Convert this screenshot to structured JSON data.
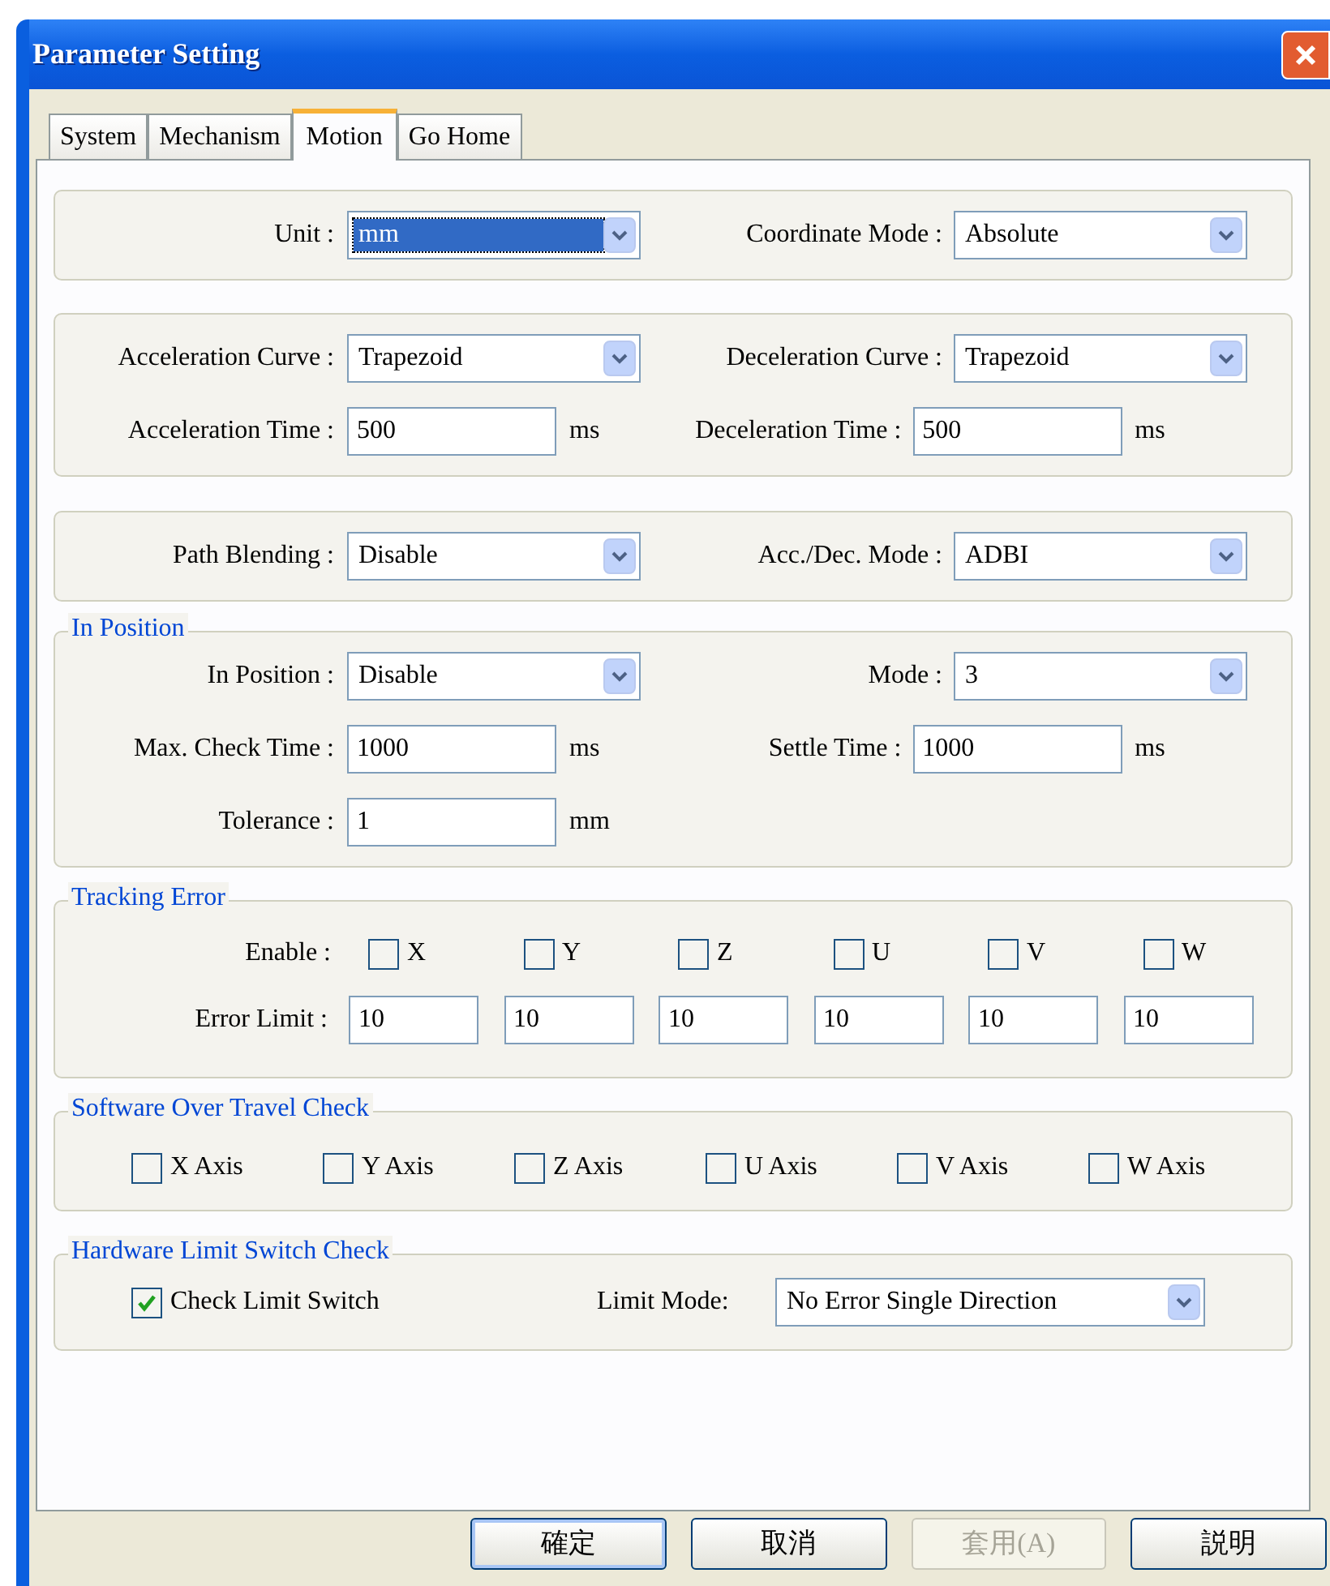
{
  "window": {
    "title": "Parameter Setting"
  },
  "tabs": [
    {
      "label": "System",
      "selected": false
    },
    {
      "label": "Mechanism",
      "selected": false
    },
    {
      "label": "Motion",
      "selected": true
    },
    {
      "label": "Go Home",
      "selected": false
    }
  ],
  "sections": [
    {
      "kind": "fields",
      "rows": [
        [
          {
            "kind": "select",
            "label": "Unit :",
            "value": "mm",
            "focused": true
          },
          {
            "kind": "select",
            "label": "Coordinate Mode :",
            "value": "Absolute",
            "focused": false
          }
        ]
      ]
    },
    {
      "kind": "fields",
      "rows": [
        [
          {
            "kind": "select",
            "label": "Acceleration Curve :",
            "value": "Trapezoid",
            "focused": false
          },
          {
            "kind": "select",
            "label": "Deceleration Curve :",
            "value": "Trapezoid",
            "focused": false
          }
        ],
        [
          {
            "kind": "input",
            "label": "Acceleration Time :",
            "value": "500",
            "unit": "ms"
          },
          {
            "kind": "input",
            "label": "Deceleration Time :",
            "value": "500",
            "unit": "ms"
          }
        ]
      ]
    },
    {
      "kind": "fields",
      "rows": [
        [
          {
            "kind": "select",
            "label": "Path Blending :",
            "value": "Disable",
            "focused": false
          },
          {
            "kind": "select",
            "label": "Acc./Dec. Mode :",
            "value": "ADBI",
            "focused": false
          }
        ]
      ]
    },
    {
      "kind": "fields",
      "title": "In Position",
      "rows": [
        [
          {
            "kind": "select",
            "label": "In Position :",
            "value": "Disable",
            "focused": false
          },
          {
            "kind": "select",
            "label": "Mode :",
            "value": "3",
            "focused": false
          }
        ],
        [
          {
            "kind": "input",
            "label": "Max. Check Time :",
            "value": "1000",
            "unit": "ms"
          },
          {
            "kind": "input",
            "label": "Settle Time :",
            "value": "1000",
            "unit": "ms"
          }
        ],
        [
          {
            "kind": "input",
            "label": "Tolerance :",
            "value": "1",
            "unit": "mm"
          }
        ]
      ]
    },
    {
      "kind": "axes",
      "title": "Tracking Error",
      "enable_label": "Enable :",
      "limit_label": "Error Limit :",
      "axes": [
        {
          "name": "X",
          "checked": false,
          "limit": "10"
        },
        {
          "name": "Y",
          "checked": false,
          "limit": "10"
        },
        {
          "name": "Z",
          "checked": false,
          "limit": "10"
        },
        {
          "name": "U",
          "checked": false,
          "limit": "10"
        },
        {
          "name": "V",
          "checked": false,
          "limit": "10"
        },
        {
          "name": "W",
          "checked": false,
          "limit": "10"
        }
      ]
    },
    {
      "kind": "checks",
      "title": "Software Over Travel Check",
      "items": [
        {
          "label": "X Axis",
          "checked": false
        },
        {
          "label": "Y Axis",
          "checked": false
        },
        {
          "label": "Z Axis",
          "checked": false
        },
        {
          "label": "U Axis",
          "checked": false
        },
        {
          "label": "V Axis",
          "checked": false
        },
        {
          "label": "W Axis",
          "checked": false
        }
      ]
    },
    {
      "kind": "limit",
      "title": "Hardware Limit Switch Check",
      "check": {
        "label": "Check Limit Switch",
        "checked": true
      },
      "mode_label": "Limit Mode:",
      "mode_value": "No Error Single Direction"
    }
  ],
  "buttons": [
    {
      "label": "確定",
      "default": true,
      "disabled": false
    },
    {
      "label": "取消",
      "default": false,
      "disabled": false
    },
    {
      "label": "套用(A)",
      "default": false,
      "disabled": true
    },
    {
      "label": "説明",
      "default": false,
      "disabled": false
    }
  ]
}
